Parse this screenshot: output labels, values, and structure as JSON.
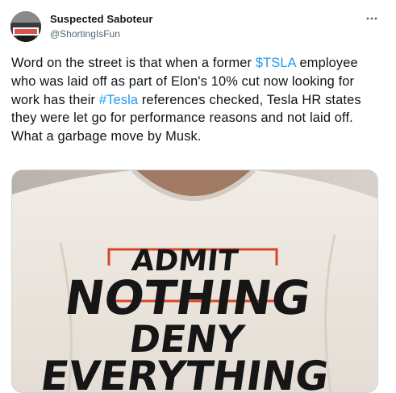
{
  "author": {
    "display_name": "Suspected Saboteur",
    "handle": "@ShortingIsFun",
    "avatar_icon": "avatar-image"
  },
  "menu": {
    "icon": "more-options-icon"
  },
  "tweet": {
    "segments": [
      "Word on the street is that when a former ",
      "$TSLA",
      " employee who was laid off as part of Elon's 10% cut now looking for work has their ",
      "#Tesla",
      " references checked, Tesla HR states they were let go for performance reasons and not laid off. What a garbage move by Musk."
    ],
    "link_color": "#1d9bf0"
  },
  "media": {
    "shirt_text": [
      "ADMIT",
      "NOTHING",
      "DENY",
      "EVERYTHING"
    ]
  }
}
